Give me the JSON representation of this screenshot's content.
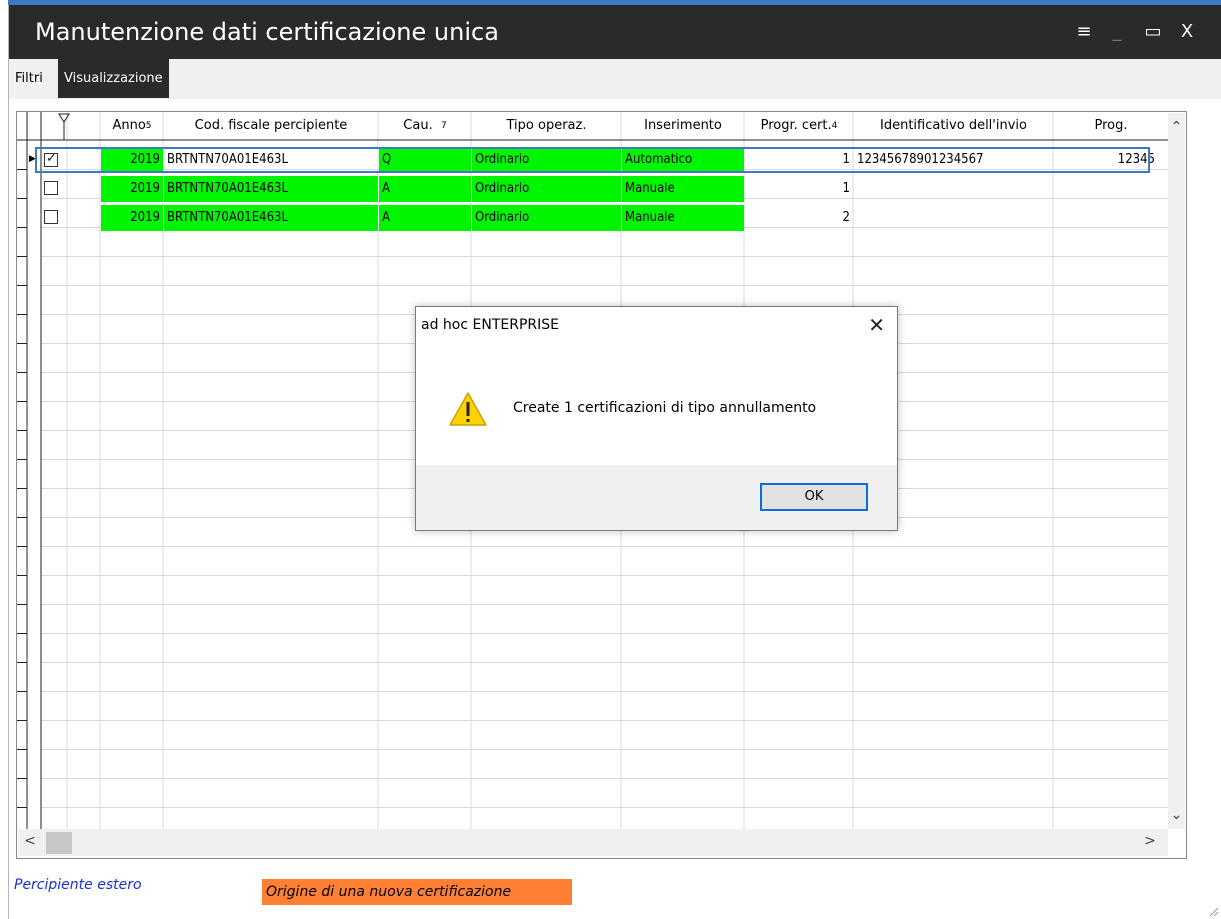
{
  "window": {
    "title": "Manutenzione dati certificazione unica"
  },
  "titlebar_icons": {
    "menu": "≡",
    "minimize": "_",
    "maximize": "▭",
    "close": "X"
  },
  "tabs": [
    {
      "label": "Filtri"
    },
    {
      "label": "Visualizzazione",
      "active": true
    }
  ],
  "table": {
    "columns": [
      {
        "label": "Anno",
        "sort": "5"
      },
      {
        "label": "Cod. fiscale percipiente"
      },
      {
        "label": "Cau.",
        "sort": "7"
      },
      {
        "label": "Tipo operaz."
      },
      {
        "label": "Inserimento"
      },
      {
        "label": "Progr. cert.",
        "sort": "4"
      },
      {
        "label": "Identificativo dell'invio"
      },
      {
        "label": "Prog."
      }
    ],
    "rows": [
      {
        "checked": true,
        "anno": "2019",
        "cod_fiscale": "BRTNTN70A01E463L",
        "cau": "Q",
        "tipo": "Ordinario",
        "inserimento": "Automatico",
        "progr_cert": "1",
        "identificativo": "12345678901234567",
        "prog": "12345"
      },
      {
        "checked": false,
        "anno": "2019",
        "cod_fiscale": "BRTNTN70A01E463L",
        "cau": "A",
        "tipo": "Ordinario",
        "inserimento": "Manuale",
        "progr_cert": "1",
        "identificativo": "",
        "prog": ""
      },
      {
        "checked": false,
        "anno": "2019",
        "cod_fiscale": "BRTNTN70A01E463L",
        "cau": "A",
        "tipo": "Ordinario",
        "inserimento": "Manuale",
        "progr_cert": "2",
        "identificativo": "",
        "prog": ""
      }
    ]
  },
  "legend": {
    "percipiente_estero": "Percipiente estero",
    "origine": "Origine di una nuova certificazione"
  },
  "dialog": {
    "title": "ad hoc ENTERPRISE",
    "message": "Create 1 certificazioni di tipo annullamento",
    "ok_label": "OK"
  },
  "colors": {
    "row_highlight": "#00f500",
    "origine_highlight": "#ff8033",
    "accent": "#3c7bc1",
    "titlebar": "#2a2a2a",
    "legend_blue": "#1b2fd6"
  }
}
